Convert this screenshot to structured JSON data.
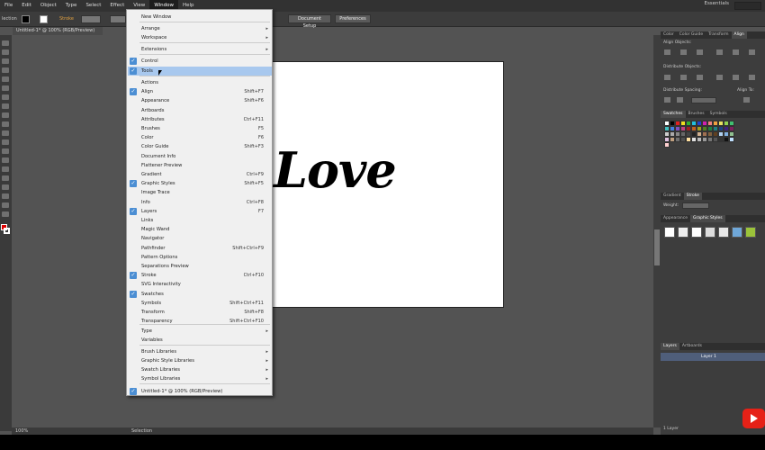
{
  "menubar": {
    "items": [
      "File",
      "Edit",
      "Object",
      "Type",
      "Select",
      "Effect",
      "View",
      "Window",
      "Help"
    ],
    "active": "Window",
    "workspace": "Essentials"
  },
  "controlbar": {
    "selection_label": "lection",
    "stroke_label": "Stroke",
    "doc_setup": "Document Setup",
    "preferences": "Preferences"
  },
  "document": {
    "tab_title": "Untitled-1* @ 100% (RGB/Preview)",
    "artwork_text": "Love",
    "zoom": "100%",
    "status_tool": "Selection"
  },
  "window_menu": {
    "items": [
      {
        "label": "New Window",
        "shortcut": "",
        "submenu": false,
        "checked": false
      },
      {
        "label": "Arrange",
        "shortcut": "",
        "submenu": true,
        "checked": false
      },
      {
        "label": "Workspace",
        "shortcut": "",
        "submenu": true,
        "checked": false
      },
      {
        "label": "Extensions",
        "shortcut": "",
        "submenu": true,
        "checked": false
      },
      {
        "label": "Control",
        "shortcut": "",
        "submenu": false,
        "checked": true
      },
      {
        "label": "Tools",
        "shortcut": "",
        "submenu": false,
        "checked": true,
        "highlighted": true
      },
      {
        "label": "Actions",
        "shortcut": "",
        "submenu": false,
        "checked": false
      },
      {
        "label": "Align",
        "shortcut": "Shift+F7",
        "submenu": false,
        "checked": true
      },
      {
        "label": "Appearance",
        "shortcut": "Shift+F6",
        "submenu": false,
        "checked": false
      },
      {
        "label": "Artboards",
        "shortcut": "",
        "submenu": false,
        "checked": false
      },
      {
        "label": "Attributes",
        "shortcut": "Ctrl+F11",
        "submenu": false,
        "checked": false
      },
      {
        "label": "Brushes",
        "shortcut": "F5",
        "submenu": false,
        "checked": false
      },
      {
        "label": "Color",
        "shortcut": "F6",
        "submenu": false,
        "checked": false
      },
      {
        "label": "Color Guide",
        "shortcut": "Shift+F3",
        "submenu": false,
        "checked": false
      },
      {
        "label": "Document Info",
        "shortcut": "",
        "submenu": false,
        "checked": false
      },
      {
        "label": "Flattener Preview",
        "shortcut": "",
        "submenu": false,
        "checked": false
      },
      {
        "label": "Gradient",
        "shortcut": "Ctrl+F9",
        "submenu": false,
        "checked": false
      },
      {
        "label": "Graphic Styles",
        "shortcut": "Shift+F5",
        "submenu": false,
        "checked": true
      },
      {
        "label": "Image Trace",
        "shortcut": "",
        "submenu": false,
        "checked": false
      },
      {
        "label": "Info",
        "shortcut": "Ctrl+F8",
        "submenu": false,
        "checked": false
      },
      {
        "label": "Layers",
        "shortcut": "F7",
        "submenu": false,
        "checked": true
      },
      {
        "label": "Links",
        "shortcut": "",
        "submenu": false,
        "checked": false
      },
      {
        "label": "Magic Wand",
        "shortcut": "",
        "submenu": false,
        "checked": false
      },
      {
        "label": "Navigator",
        "shortcut": "",
        "submenu": false,
        "checked": false
      },
      {
        "label": "Pathfinder",
        "shortcut": "Shift+Ctrl+F9",
        "submenu": false,
        "checked": false
      },
      {
        "label": "Pattern Options",
        "shortcut": "",
        "submenu": false,
        "checked": false
      },
      {
        "label": "Separations Preview",
        "shortcut": "",
        "submenu": false,
        "checked": false
      },
      {
        "label": "Stroke",
        "shortcut": "Ctrl+F10",
        "submenu": false,
        "checked": true
      },
      {
        "label": "SVG Interactivity",
        "shortcut": "",
        "submenu": false,
        "checked": false
      },
      {
        "label": "Swatches",
        "shortcut": "",
        "submenu": false,
        "checked": true
      },
      {
        "label": "Symbols",
        "shortcut": "Shift+Ctrl+F11",
        "submenu": false,
        "checked": false
      },
      {
        "label": "Transform",
        "shortcut": "Shift+F8",
        "submenu": false,
        "checked": false
      },
      {
        "label": "Transparency",
        "shortcut": "Shift+Ctrl+F10",
        "submenu": false,
        "checked": false
      },
      {
        "label": "Type",
        "shortcut": "",
        "submenu": true,
        "checked": false
      },
      {
        "label": "Variables",
        "shortcut": "",
        "submenu": false,
        "checked": false
      },
      {
        "label": "Brush Libraries",
        "shortcut": "",
        "submenu": true,
        "checked": false
      },
      {
        "label": "Graphic Style Libraries",
        "shortcut": "",
        "submenu": true,
        "checked": false
      },
      {
        "label": "Swatch Libraries",
        "shortcut": "",
        "submenu": true,
        "checked": false
      },
      {
        "label": "Symbol Libraries",
        "shortcut": "",
        "submenu": true,
        "checked": false
      },
      {
        "label": "Untitled-1* @ 100% (RGB/Preview)",
        "shortcut": "",
        "submenu": false,
        "checked": true
      }
    ]
  },
  "panels": {
    "top_tabs": [
      "Color",
      "Color Guide",
      "Transform",
      "Align"
    ],
    "align_objects": "Align Objects:",
    "distribute_objects": "Distribute Objects:",
    "distribute_spacing": "Distribute Spacing:",
    "align_to": "Align To:",
    "swatch_tabs": [
      "Swatches",
      "Brushes",
      "Symbols"
    ],
    "stroke_tabs": [
      "Gradient",
      "Stroke"
    ],
    "weight_label": "Weight:",
    "appearance_tabs": [
      "Appearance",
      "Graphic Styles"
    ],
    "layer_tabs": [
      "Layers",
      "Artboards"
    ],
    "layer_name": "Layer 1",
    "layer_count": "1 Layer"
  }
}
